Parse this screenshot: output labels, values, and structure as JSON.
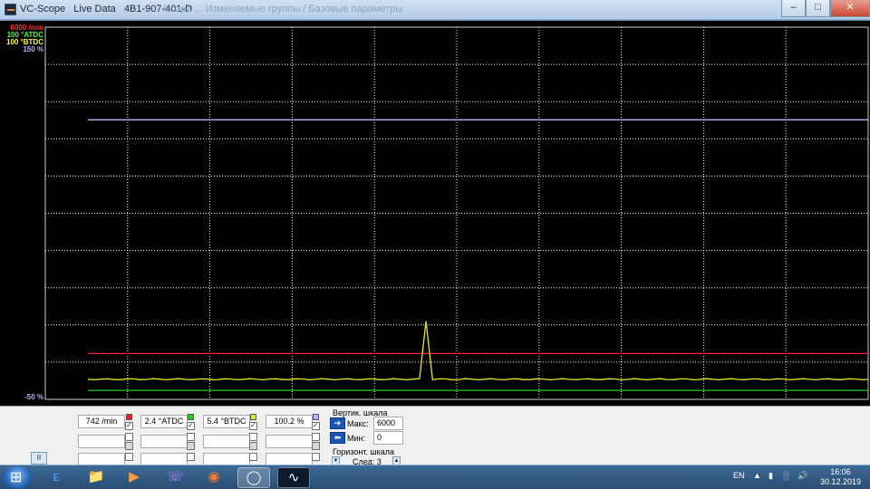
{
  "window": {
    "title": "VC-Scope   Live Data   4B1-907-401-D",
    "ghost_title": "Scope ... Изменяемые группы / Базовые параметры",
    "min_label": "–",
    "max_label": "□",
    "close_label": "✕"
  },
  "scope": {
    "legend": {
      "rpm_max": "6000 /min",
      "atdc_max": "100 °ATDC",
      "btdc_max": "100 °BTDC",
      "pct_max": "150 %",
      "pct_min": "-50 %"
    },
    "colors": {
      "rpm": "#ff2020",
      "atdc": "#20d020",
      "btdc": "#e8e820",
      "pct": "#b4b4ff",
      "grid": "#ffffff"
    },
    "channels": [
      {
        "id": "rpm",
        "level_fraction": 0.123
      },
      {
        "id": "atdc",
        "level_fraction": 0.024
      },
      {
        "id": "btdc",
        "level_fraction": 0.054,
        "spike_fraction": 0.21
      },
      {
        "id": "pct",
        "level_fraction": 0.751
      }
    ]
  },
  "panel": {
    "values": [
      {
        "text": "742 /min",
        "color": "#e82020",
        "checked": true
      },
      {
        "text": "2.4 °ATDC",
        "color": "#20d020",
        "checked": true
      },
      {
        "text": "5.4 °BTDC",
        "color": "#e8e820",
        "checked": true
      },
      {
        "text": "100.2 %",
        "color": "#b4b4ff",
        "checked": true
      }
    ],
    "vertical_scale_label": "Вертик. шкала",
    "max_label": "Макс:",
    "max_value": "6000",
    "min_label": "Мин:",
    "min_value": "0",
    "horizontal_scale_label": "Горизонт. шкала",
    "horizontal_value": "След: 3",
    "pause_label": "II"
  },
  "taskbar": {
    "lang": "EN",
    "time": "16:06",
    "date": "30.12.2019",
    "icons": [
      "start-icon",
      "ie-icon",
      "explorer-icon",
      "media-player-icon",
      "viber-icon",
      "firefox-icon",
      "vcds-icon",
      "vc-scope-icon"
    ]
  }
}
